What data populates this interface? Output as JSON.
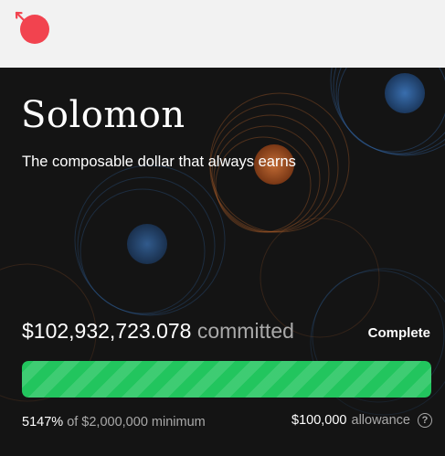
{
  "header": {
    "logo_icon": "red-orb-arrow-icon",
    "logo_color": "#f2434f"
  },
  "project": {
    "name": "Solomon",
    "tagline": "The composable dollar that always earns"
  },
  "raise": {
    "committed_amount": "$102,932,723.078",
    "committed_suffix": "committed",
    "status": "Complete",
    "progress_fraction": 1.0,
    "progress_color": "#22c55e",
    "percent_of_minimum": "5147%",
    "minimum_text": "of $2,000,000 minimum",
    "allowance_amount": "$100,000",
    "allowance_label": "allowance",
    "help_icon": "question-circle-icon"
  },
  "theme": {
    "card_background": "#141414",
    "accent_orange": "#c2692e",
    "accent_blue": "#2f5c93"
  }
}
